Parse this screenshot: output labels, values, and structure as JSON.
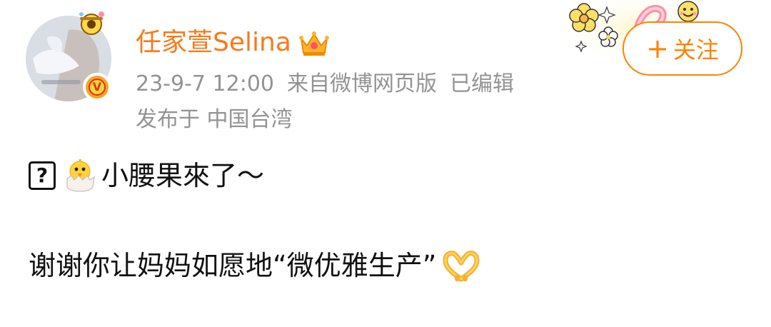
{
  "post": {
    "username": "任家萱Selina",
    "timestamp": "23-9-7 12:00",
    "source": "来自微博网页版",
    "edited": "已编辑",
    "location": "发布于 中国台湾",
    "verified_badge": "V",
    "lines": [
      {
        "icon_glyph": "?",
        "text": "小腰果來了～"
      },
      {
        "text": "谢谢你让妈妈如愿地“微优雅生产”"
      }
    ]
  },
  "follow_button": {
    "plus": "+",
    "label": "关注"
  },
  "colors": {
    "username": "#f77b1a",
    "meta_text": "#939393",
    "accent": "#ff8200",
    "body_text": "#111111"
  },
  "icons": {
    "crown": "crown-icon",
    "verified": "verified-badge-icon",
    "chick": "hatching-chick-icon",
    "heart_hands": "heart-hands-icon",
    "missing_glyph": "unknown-glyph-icon",
    "pendant": "avatar-pendant-icon"
  }
}
